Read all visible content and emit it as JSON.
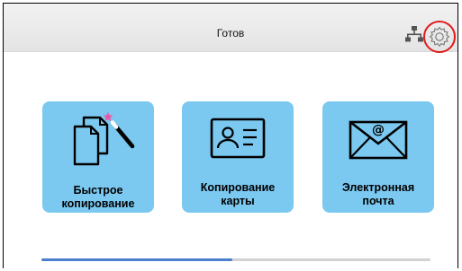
{
  "status_bar": {
    "status_text": "Готов",
    "network_icon": "network-icon",
    "settings_icon": "gear-icon",
    "settings_highlight_color": "#e01b1b"
  },
  "tiles": [
    {
      "label_line1": "Быстрое",
      "label_line2": "копирование",
      "icon": "quick-copy-icon"
    },
    {
      "label_line1": "Копирование",
      "label_line2": "карты",
      "icon": "id-card-icon"
    },
    {
      "label_line1": "Электронная",
      "label_line2": "почта",
      "icon": "email-icon"
    }
  ],
  "page_indicator": {
    "progress": 0.49
  },
  "colors": {
    "tile_background": "#7bc8f0",
    "indicator_fill": "#4a7fd0",
    "indicator_track": "#d2d2d2"
  }
}
